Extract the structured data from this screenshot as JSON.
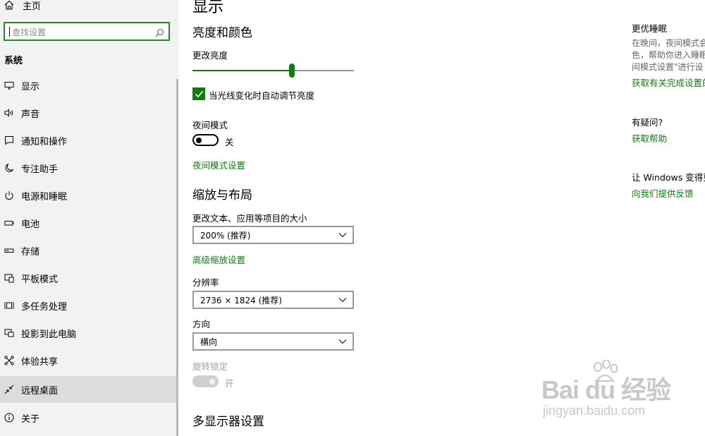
{
  "sidebar": {
    "home_label": "主页",
    "search_placeholder": "查找设置",
    "section_title": "系统",
    "items": [
      {
        "label": "显示",
        "icon": "monitor-icon"
      },
      {
        "label": "声音",
        "icon": "speaker-icon"
      },
      {
        "label": "通知和操作",
        "icon": "message-icon"
      },
      {
        "label": "专注助手",
        "icon": "moon-icon"
      },
      {
        "label": "电源和睡眠",
        "icon": "power-icon"
      },
      {
        "label": "电池",
        "icon": "battery-icon"
      },
      {
        "label": "存储",
        "icon": "storage-icon"
      },
      {
        "label": "平板模式",
        "icon": "tablet-mode-icon"
      },
      {
        "label": "多任务处理",
        "icon": "multitask-icon"
      },
      {
        "label": "投影到此电脑",
        "icon": "project-icon"
      },
      {
        "label": "体验共享",
        "icon": "share-icon"
      },
      {
        "label": "远程桌面",
        "icon": "remote-desktop-icon",
        "active": true
      },
      {
        "label": "关于",
        "icon": "info-icon"
      }
    ]
  },
  "main": {
    "page_title": "显示",
    "brightness_section": "亮度和颜色",
    "brightness_label": "更改亮度",
    "brightness_value_fraction": 0.6,
    "auto_brightness_label": "当光线变化时自动调节亮度",
    "auto_brightness_checked": true,
    "night_mode_label": "夜间模式",
    "night_mode_state": "关",
    "night_mode_settings_link": "夜间模式设置",
    "scale_section": "缩放与布局",
    "text_size_label": "更改文本、应用等项目的大小",
    "text_size_value": "200% (推荐)",
    "advanced_scale_link": "高级缩放设置",
    "resolution_label": "分辨率",
    "resolution_value": "2736 × 1824 (推荐)",
    "orientation_label": "方向",
    "orientation_value": "横向",
    "rotation_lock_label": "旋转锁定",
    "rotation_lock_state": "开",
    "multi_display_section": "多显示器设置"
  },
  "right_panel": {
    "sleep_title": "更优睡眠",
    "sleep_line1": "在晚间，夜间模式会",
    "sleep_line2": "色，帮助你进入睡眠",
    "sleep_line3": "间模式设置\"进行设",
    "sleep_link": "获取有关完成设置的",
    "question_title": "有疑问?",
    "help_link": "获取帮助",
    "feedback_title": "让 Windows 变得更",
    "feedback_link": "向我们提供反馈"
  },
  "watermark": {
    "brand": "Bai du 经验",
    "url": "jingyan.baidu.com"
  },
  "colors": {
    "accent": "#107c10",
    "sidebar_bg": "#f2f2f2",
    "active_item_bg": "#dcdcdc"
  }
}
